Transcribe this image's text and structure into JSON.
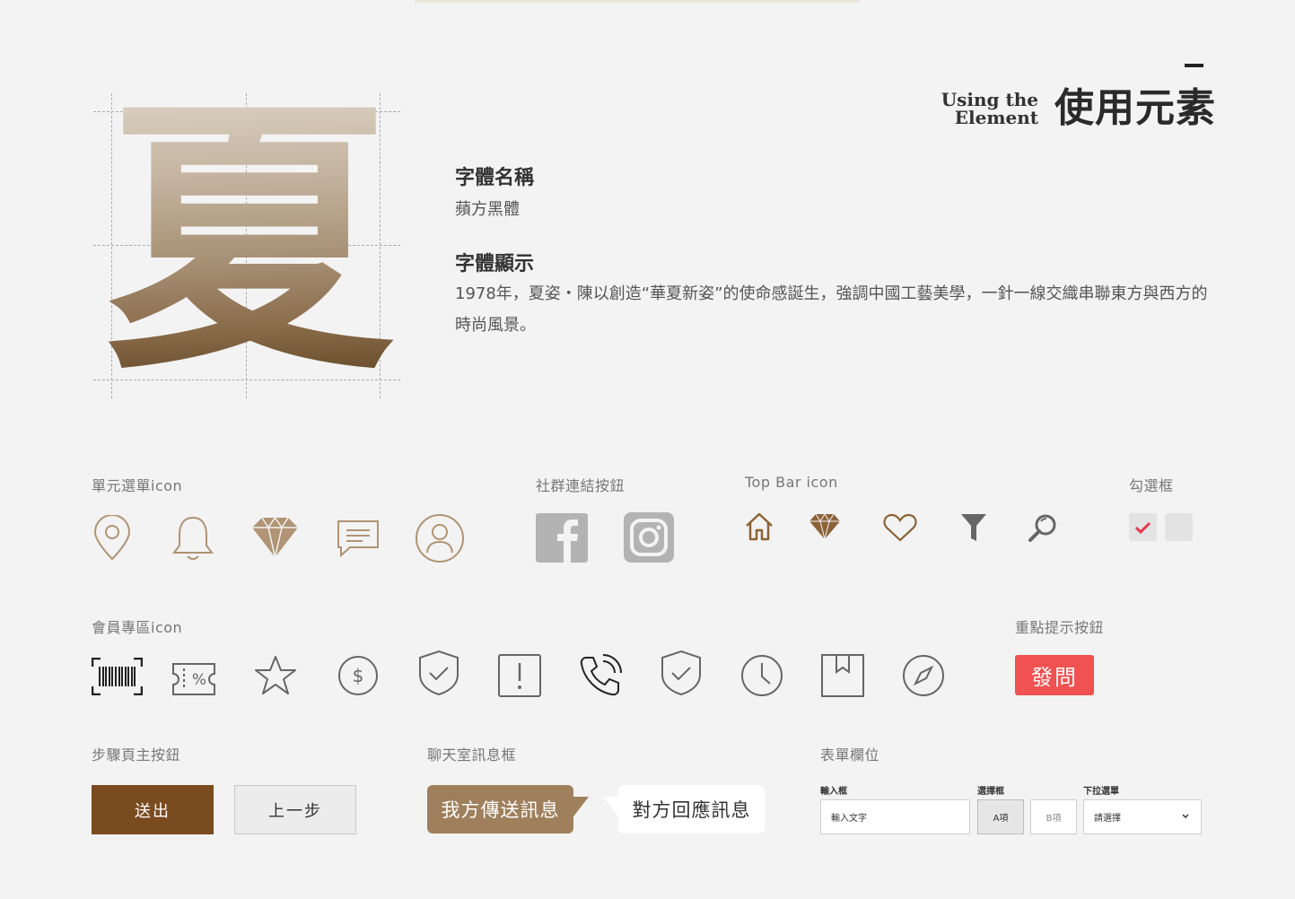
{
  "header": {
    "eng_title_line1": "Using the",
    "eng_title_line2": "Element",
    "cn_title": "使用元素"
  },
  "glyph": {
    "char": "夏"
  },
  "font_info": {
    "name_heading": "字體名稱",
    "name_value": "蘋方黑體",
    "display_heading": "字體顯示",
    "display_text": "1978年，夏姿・陳以創造“華夏新姿”的使命感誕生，強調中國工藝美學，一針一線交織串聯東方與西方的時尚風景。"
  },
  "sections": {
    "menu_icons": "單元選單icon",
    "social_buttons": "社群連結按鈕",
    "topbar_icons": "Top Bar icon",
    "checkbox": "勾選框",
    "member_icons": "會員專區icon",
    "highlight_button": "重點提示按鈕",
    "step_buttons": "步驟頁主按鈕",
    "chat_box": "聊天室訊息框",
    "form_fields": "表單欄位"
  },
  "buttons": {
    "ask": "發問",
    "submit": "送出",
    "previous": "上一步"
  },
  "chat": {
    "sent": "我方傳送訊息",
    "received": "對方回應訊息"
  },
  "form": {
    "input_label": "輸入框",
    "input_value": "輸入文字",
    "radio_label": "選擇框",
    "option_a": "A項",
    "option_b": "B項",
    "dropdown_label": "下拉選單",
    "dropdown_value": "請選擇"
  },
  "colors": {
    "background": "#f3f3f3",
    "gold": "#b09474",
    "brown_primary": "#7a4b1f",
    "chat_brown": "#a0805c",
    "alert_red": "#f05151",
    "check_red": "#e8384d",
    "social_gray": "#b3b3b3",
    "icon_gray": "#666666"
  },
  "icons": {
    "menu": [
      "location-pin-icon",
      "bell-icon",
      "diamond-icon",
      "chat-icon",
      "user-icon"
    ],
    "social": [
      "facebook-icon",
      "instagram-icon"
    ],
    "topbar": [
      "home-icon",
      "diamond-icon",
      "heart-icon",
      "filter-icon",
      "search-icon"
    ],
    "member": [
      "barcode-icon",
      "coupon-icon",
      "star-icon",
      "dollar-icon",
      "shield-check-icon",
      "alert-icon",
      "phone-icon",
      "shield-check-icon",
      "clock-icon",
      "bookmark-icon",
      "compass-icon"
    ]
  }
}
